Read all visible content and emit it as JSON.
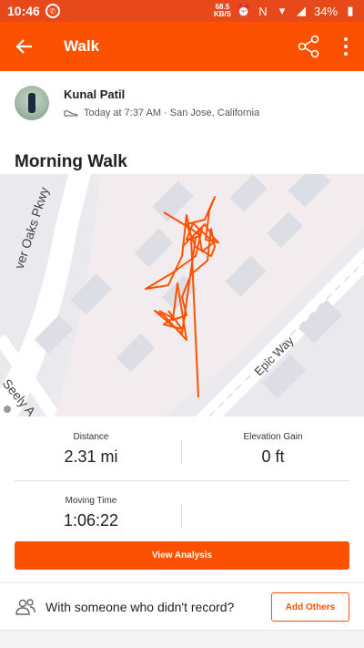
{
  "status_bar": {
    "time": "10:46",
    "speed_value": "68.5",
    "speed_unit": "KB/S",
    "battery": "34%"
  },
  "app_bar": {
    "title": "Walk"
  },
  "athlete": {
    "name": "Kunal Patil",
    "meta": "Today at 7:37 AM · San Jose, California"
  },
  "activity": {
    "title": "Morning Walk"
  },
  "map": {
    "street_labels": [
      "ver Oaks Pkwy",
      "Epic Way",
      "Seely A"
    ],
    "route_color": "#fc5200"
  },
  "stats": {
    "distance": {
      "label": "Distance",
      "value": "2.31 mi"
    },
    "elevation": {
      "label": "Elevation Gain",
      "value": "0 ft"
    },
    "moving_time": {
      "label": "Moving Time",
      "value": "1:06:22"
    }
  },
  "buttons": {
    "view_analysis": "View Analysis",
    "add_others": "Add Others"
  },
  "others": {
    "prompt": "With someone who didn't record?"
  }
}
